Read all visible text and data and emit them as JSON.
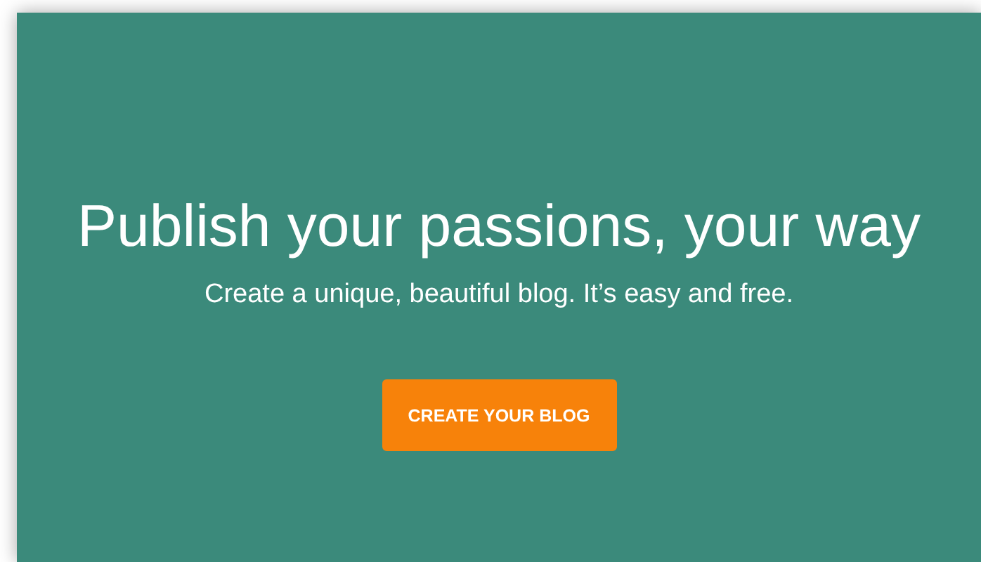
{
  "hero": {
    "title": "Publish your passions, your way",
    "subtitle": "Create a unique, beautiful blog. It’s easy and free.",
    "button": "CREATE YOUR BLOG"
  }
}
